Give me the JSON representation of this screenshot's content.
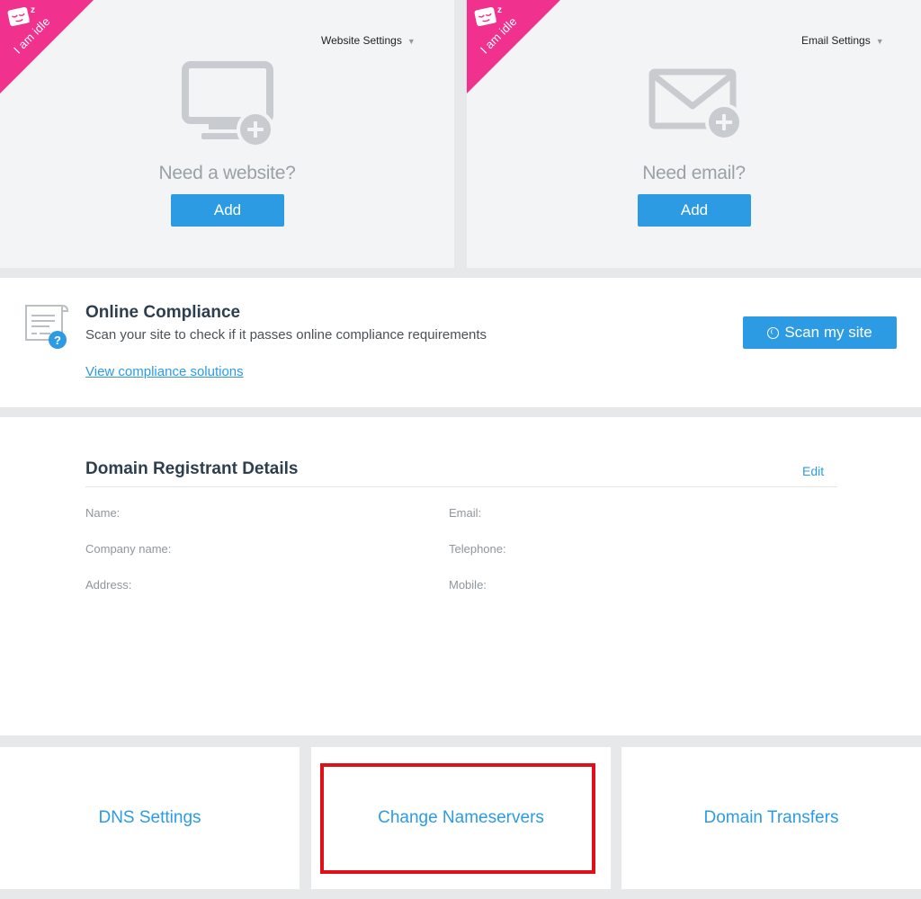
{
  "website_card": {
    "ribbon_text": "I am idle",
    "ribbon_zz": "z z",
    "settings_label": "Website Settings",
    "prompt": "Need a website?",
    "add_label": "Add",
    "icon": "monitor-add-icon"
  },
  "email_card": {
    "ribbon_text": "I am idle",
    "ribbon_zz": "z z",
    "settings_label": "Email Settings",
    "prompt": "Need email?",
    "add_label": "Add",
    "icon": "envelope-add-icon"
  },
  "compliance": {
    "title": "Online Compliance",
    "description": "Scan your site to check if it passes online compliance requirements",
    "link": "View compliance solutions",
    "scan_label": "Scan my site",
    "icon": "document-question-icon"
  },
  "registrant": {
    "title": "Domain Registrant Details",
    "edit_label": "Edit",
    "fields": {
      "name": "Name:",
      "company": "Company name:",
      "address": "Address:",
      "email": "Email:",
      "telephone": "Telephone:",
      "mobile": "Mobile:"
    }
  },
  "tiles": {
    "dns": "DNS Settings",
    "nameservers": "Change Nameservers",
    "transfers": "Domain Transfers"
  },
  "colors": {
    "accent": "#2d9be4",
    "ribbon": "#f0318e",
    "highlight": "#e01018",
    "title": "#2d3e4f"
  }
}
